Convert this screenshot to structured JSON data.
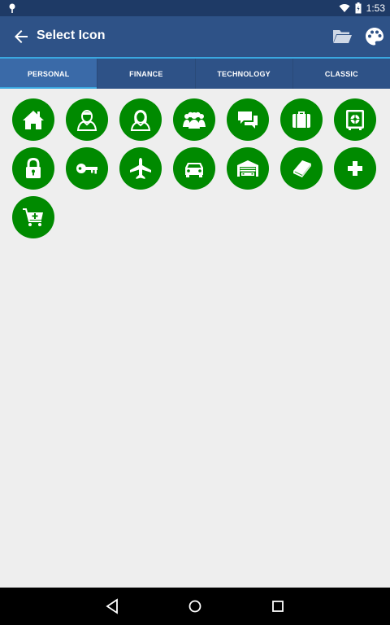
{
  "status_bar": {
    "time": "1:53"
  },
  "app_bar": {
    "title": "Select Icon"
  },
  "tabs": [
    {
      "label": "PERSONAL",
      "active": true
    },
    {
      "label": "FINANCE",
      "active": false
    },
    {
      "label": "TECHNOLOGY",
      "active": false
    },
    {
      "label": "CLASSIC",
      "active": false
    }
  ],
  "icons": [
    {
      "name": "home-icon"
    },
    {
      "name": "man-icon"
    },
    {
      "name": "woman-icon"
    },
    {
      "name": "group-icon"
    },
    {
      "name": "chat-icon"
    },
    {
      "name": "briefcase-icon"
    },
    {
      "name": "safe-icon"
    },
    {
      "name": "lock-icon"
    },
    {
      "name": "key-icon"
    },
    {
      "name": "airplane-icon"
    },
    {
      "name": "car-icon"
    },
    {
      "name": "garage-icon"
    },
    {
      "name": "book-icon"
    },
    {
      "name": "medical-cross-icon"
    },
    {
      "name": "cart-add-icon"
    }
  ],
  "colors": {
    "status_bar": "#1e3a66",
    "app_bar": "#2e5287",
    "accent": "#3aa8e0",
    "icon_bg": "#008a00",
    "background": "#eeeeee"
  }
}
